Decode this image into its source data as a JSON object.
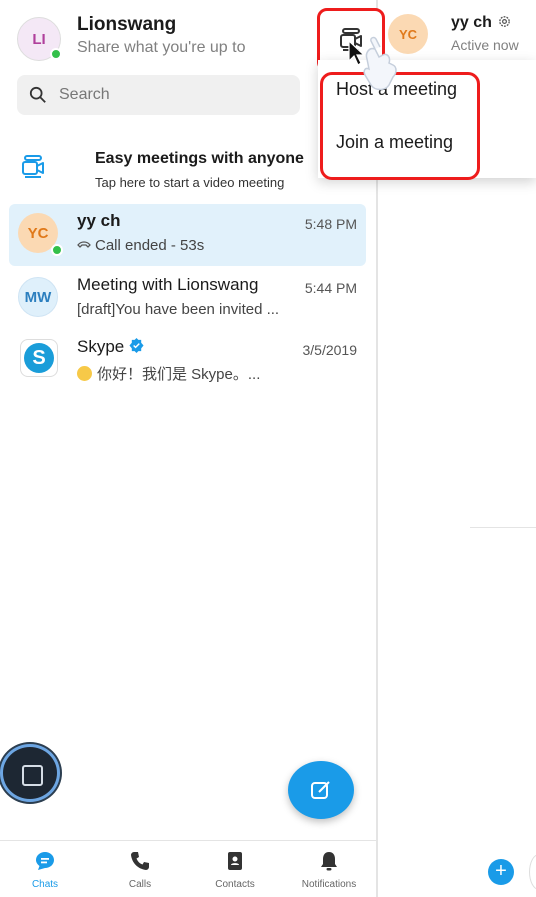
{
  "profile": {
    "initials": "LI",
    "name": "Lionswang",
    "status": "Share what you're up to"
  },
  "search": {
    "placeholder": "Search"
  },
  "promo": {
    "title": "Easy meetings with anyone",
    "subtitle": "Tap here to start a video meeting",
    "close": "✕"
  },
  "chats": [
    {
      "initials": "YC",
      "name": "yy ch",
      "time": "5:48 PM",
      "preview": "Call ended - 53s",
      "active": true
    },
    {
      "initials": "MW",
      "name": "Meeting with Lionswang",
      "time": "5:44 PM",
      "preview": "[draft]You have been invited ..."
    },
    {
      "initials": "S",
      "name": "Skype",
      "time": "3/5/2019",
      "preview": "你好！我们是 Skype。..."
    }
  ],
  "menu": {
    "items": [
      "Host a meeting",
      "Join a meeting"
    ]
  },
  "right_header": {
    "initials": "YC",
    "name": "yy ch",
    "status": "Active now"
  },
  "tabs": [
    {
      "label": "Chats",
      "icon": "chat-bubble-icon",
      "active": true
    },
    {
      "label": "Calls",
      "icon": "phone-icon"
    },
    {
      "label": "Contacts",
      "icon": "contacts-book-icon"
    },
    {
      "label": "Notifications",
      "icon": "bell-icon"
    }
  ],
  "colors": {
    "accent": "#1a9be8",
    "highlight_border": "#ee1c1c",
    "active_chat_bg": "#e1f1fb",
    "online": "#33c04a"
  }
}
